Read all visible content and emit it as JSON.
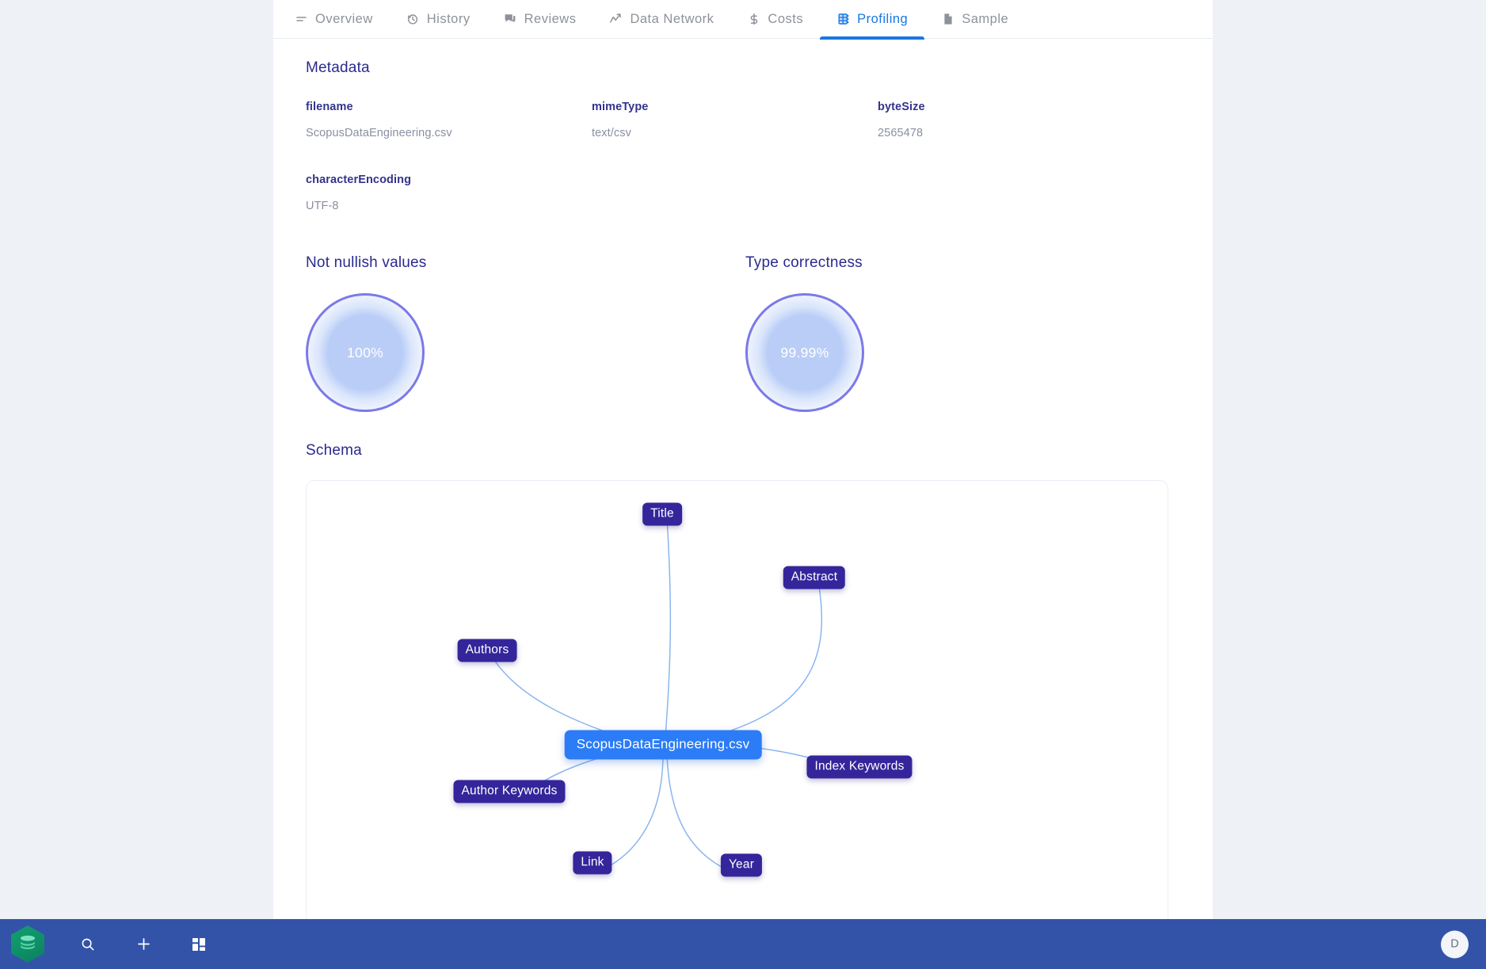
{
  "tabs": [
    {
      "label": "Overview",
      "icon": "list-lines-icon",
      "active": false
    },
    {
      "label": "History",
      "icon": "clock-history-icon",
      "active": false
    },
    {
      "label": "Reviews",
      "icon": "comment-icon",
      "active": false
    },
    {
      "label": "Data Network",
      "icon": "trending-up-icon",
      "active": false
    },
    {
      "label": "Costs",
      "icon": "dollar-icon",
      "active": false
    },
    {
      "label": "Profiling",
      "icon": "table-grid-icon",
      "active": true
    },
    {
      "label": "Sample",
      "icon": "document-icon",
      "active": false
    }
  ],
  "metadata": {
    "heading": "Metadata",
    "fields": [
      {
        "key": "filename",
        "value": "ScopusDataEngineering.csv"
      },
      {
        "key": "mimeType",
        "value": "text/csv"
      },
      {
        "key": "byteSize",
        "value": "2565478"
      },
      {
        "key": "characterEncoding",
        "value": "UTF-8"
      }
    ]
  },
  "gauges": [
    {
      "label": "Not nullish values",
      "value": "100%",
      "percent": 100
    },
    {
      "label": "Type correctness",
      "value": "99.99%",
      "percent": 99.99
    }
  ],
  "schema": {
    "heading": "Schema",
    "center": "ScopusDataEngineering.csv",
    "nodes": [
      "Title",
      "Abstract",
      "Authors",
      "Index Keywords",
      "Author Keywords",
      "Link",
      "Year"
    ]
  },
  "bottom_bar": {
    "logo": "layers-hexagon-logo",
    "actions": [
      {
        "icon": "search-icon"
      },
      {
        "icon": "plus-icon"
      },
      {
        "icon": "dashboard-grid-icon"
      }
    ],
    "avatar_initial": "D"
  },
  "colors": {
    "accent_blue": "#1878e3",
    "node_purple": "#35259b",
    "center_blue": "#2b7cf6",
    "heading_navy": "#2a2a8f",
    "bottom_bar": "#3253a8",
    "page_bg": "#eef1f6",
    "gauge_ring": "#7b79e8"
  }
}
